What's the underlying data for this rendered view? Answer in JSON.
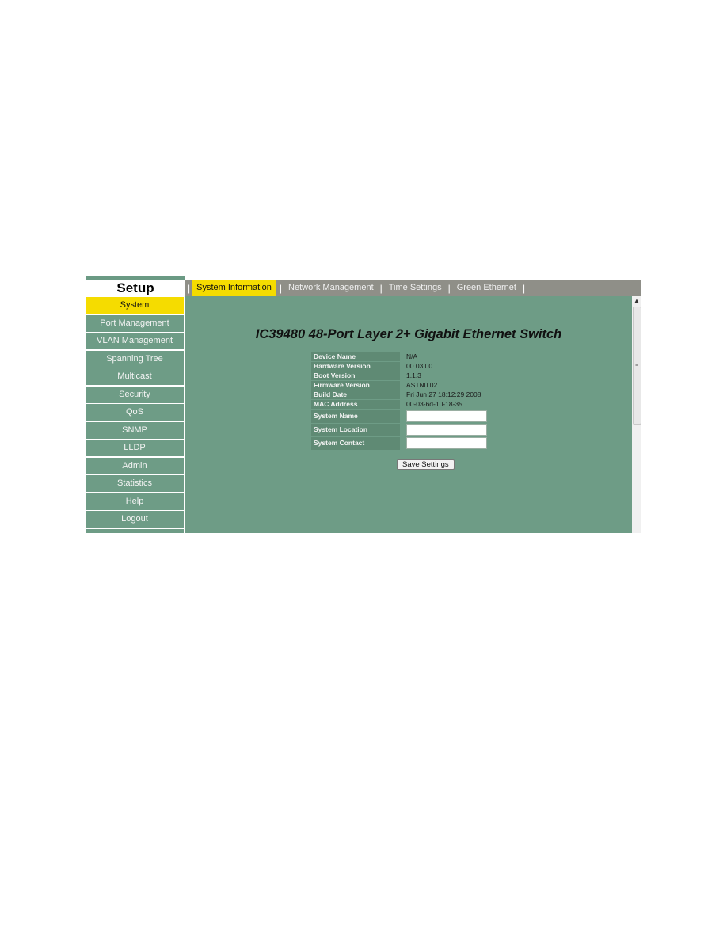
{
  "sidebar": {
    "title": "Setup",
    "items": [
      {
        "label": "System",
        "active": true
      },
      {
        "label": "Port Management"
      },
      {
        "label": "VLAN Management"
      },
      {
        "label": "Spanning Tree"
      },
      {
        "label": "Multicast"
      },
      {
        "label": "Security"
      },
      {
        "label": "QoS"
      },
      {
        "label": "SNMP"
      },
      {
        "label": "LLDP"
      },
      {
        "label": "Admin"
      },
      {
        "label": "Statistics"
      },
      {
        "label": "Help"
      },
      {
        "label": "Logout"
      }
    ]
  },
  "tabs": [
    {
      "label": "System Information",
      "active": true
    },
    {
      "label": "Network Management"
    },
    {
      "label": "Time Settings"
    },
    {
      "label": "Green Ethernet"
    }
  ],
  "main": {
    "title": "IC39480 48-Port Layer 2+ Gigabit Ethernet Switch",
    "info": [
      {
        "label": "Device Name",
        "value": "N/A"
      },
      {
        "label": "Hardware Version",
        "value": "00.03.00"
      },
      {
        "label": "Boot Version",
        "value": "1.1.3"
      },
      {
        "label": "Firmware Version",
        "value": "ASTN0.02"
      },
      {
        "label": "Build Date",
        "value": "Fri Jun 27 18:12:29 2008"
      },
      {
        "label": "MAC Address",
        "value": "00-03-6d-10-18-35"
      }
    ],
    "fields": [
      {
        "label": "System Name",
        "value": ""
      },
      {
        "label": "System Location",
        "value": ""
      },
      {
        "label": "System Contact",
        "value": ""
      }
    ],
    "save_label": "Save Settings"
  },
  "colors": {
    "accent": "#f5dc00",
    "panel": "#6e9c86",
    "tabbar": "#8f8f88"
  }
}
